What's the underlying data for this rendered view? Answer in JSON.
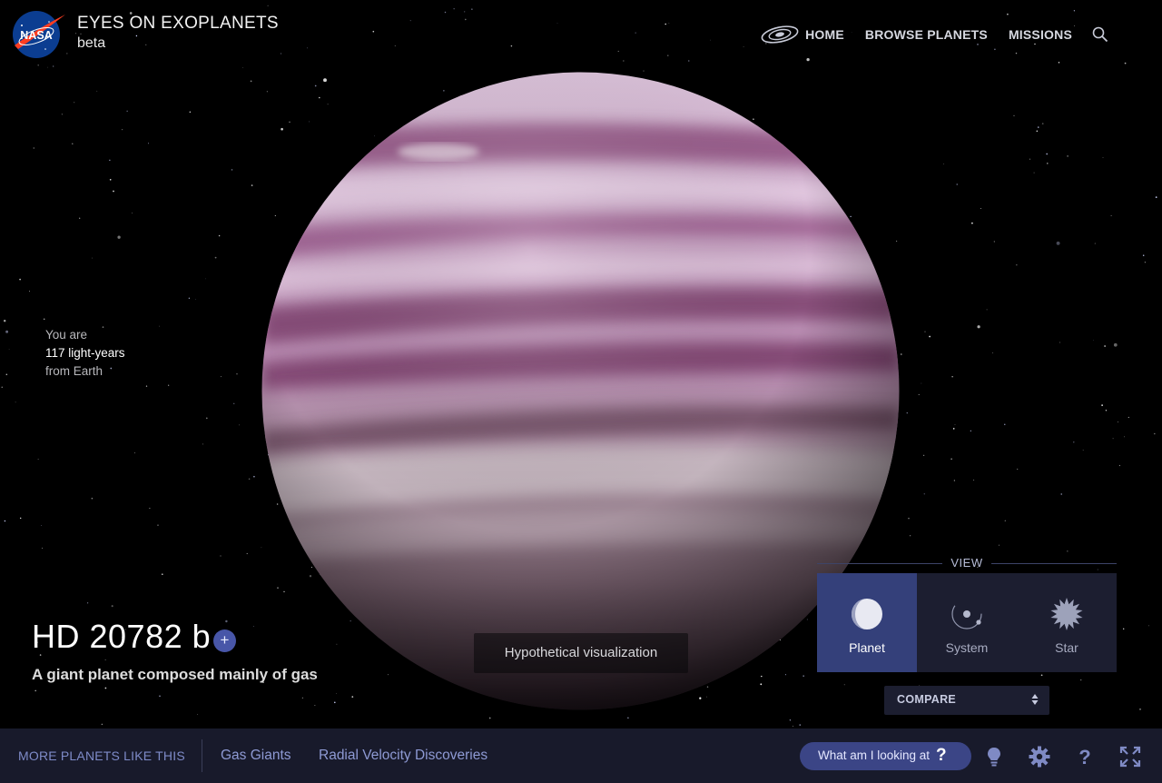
{
  "app": {
    "title": "EYES ON EXOPLANETS",
    "subtitle": "beta",
    "logo_text": "NASA"
  },
  "nav": {
    "items": [
      {
        "label": "HOME",
        "icon": "galaxy-icon"
      },
      {
        "label": "BROWSE PLANETS"
      },
      {
        "label": "MISSIONS"
      }
    ],
    "search_icon": "search-icon"
  },
  "distance": {
    "line1": "You are",
    "value": "117 light-years",
    "line3": "from Earth"
  },
  "planet": {
    "name": "HD 20782 b",
    "description": "A giant planet composed mainly of gas",
    "add_label": "+",
    "caption": "Hypothetical visualization",
    "colors": {
      "band": "#9a5f8a",
      "light": "#e6cfe4",
      "base": "#c9a6c3"
    }
  },
  "view": {
    "label": "VIEW",
    "options": [
      {
        "label": "Planet",
        "icon": "planet-icon",
        "active": true
      },
      {
        "label": "System",
        "icon": "system-orbit-icon",
        "active": false
      },
      {
        "label": "Star",
        "icon": "star-burst-icon",
        "active": false
      }
    ],
    "compare_label": "COMPARE"
  },
  "bottom": {
    "more_label": "MORE PLANETS LIKE THIS",
    "categories": [
      "Gas Giants",
      "Radial Velocity Discoveries"
    ],
    "what_label": "What am I looking at",
    "what_q": "?",
    "icons": [
      "lightbulb-icon",
      "settings-gear-icon",
      "help-icon",
      "fullscreen-icon"
    ]
  },
  "colors": {
    "accent": "#3b4586",
    "active_view": "#34407a",
    "panel": "#1c1e30",
    "bottom_bar": "#181a2b",
    "link": "#8e9ad4"
  }
}
